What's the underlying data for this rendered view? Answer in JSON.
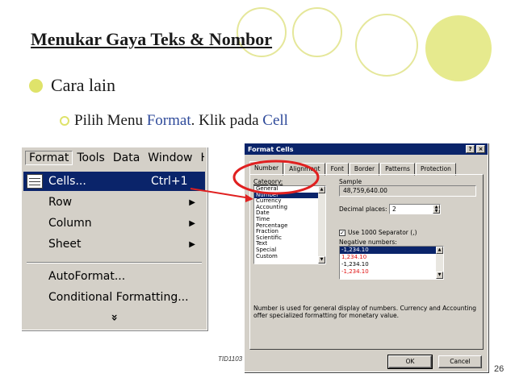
{
  "slide": {
    "title": "Menukar Gaya Teks & Nombor",
    "bullet1": "Cara lain",
    "bullet2_prefix": "Pilih Menu ",
    "bullet2_format": "Format",
    "bullet2_middle": ". Klik pada ",
    "bullet2_cell": "Cell",
    "footer": "TID1103",
    "page_number": "26"
  },
  "menubar": {
    "items": [
      "Format",
      "Tools",
      "Data",
      "Window",
      "H"
    ]
  },
  "format_menu": {
    "cells_label": "Cells...",
    "cells_shortcut": "Ctrl+1",
    "row_label": "Row",
    "column_label": "Column",
    "sheet_label": "Sheet",
    "autoformat_label": "AutoFormat...",
    "conditional_label": "Conditional Formatting...",
    "expand_glyph": "»"
  },
  "dialog": {
    "title": "Format Cells",
    "help_glyph": "?",
    "close_glyph": "×",
    "tabs": [
      "Number",
      "Alignment",
      "Font",
      "Border",
      "Patterns",
      "Protection"
    ],
    "category_label": "Category:",
    "categories": [
      "General",
      "Number",
      "Currency",
      "Accounting",
      "Date",
      "Time",
      "Percentage",
      "Fraction",
      "Scientific",
      "Text",
      "Special",
      "Custom"
    ],
    "sample_label": "Sample",
    "sample_value": "48,759,640.00",
    "decimal_label": "Decimal places:",
    "decimal_value": "2",
    "separator_label": "Use 1000 Separator (,)",
    "separator_checked": true,
    "negative_label": "Negative numbers:",
    "negative_options": [
      "-1,234.10",
      "1,234.10",
      "-1,234.10",
      "-1,234.10"
    ],
    "description": "Number is used for general display of numbers.  Currency and Accounting offer specialized formatting for monetary value.",
    "ok_label": "OK",
    "cancel_label": "Cancel"
  },
  "colors": {
    "accent_circle": "#e6ea8e",
    "highlight_text": "#2e4a9a",
    "selection": "#0a246a",
    "annotation_red": "#e02020"
  }
}
